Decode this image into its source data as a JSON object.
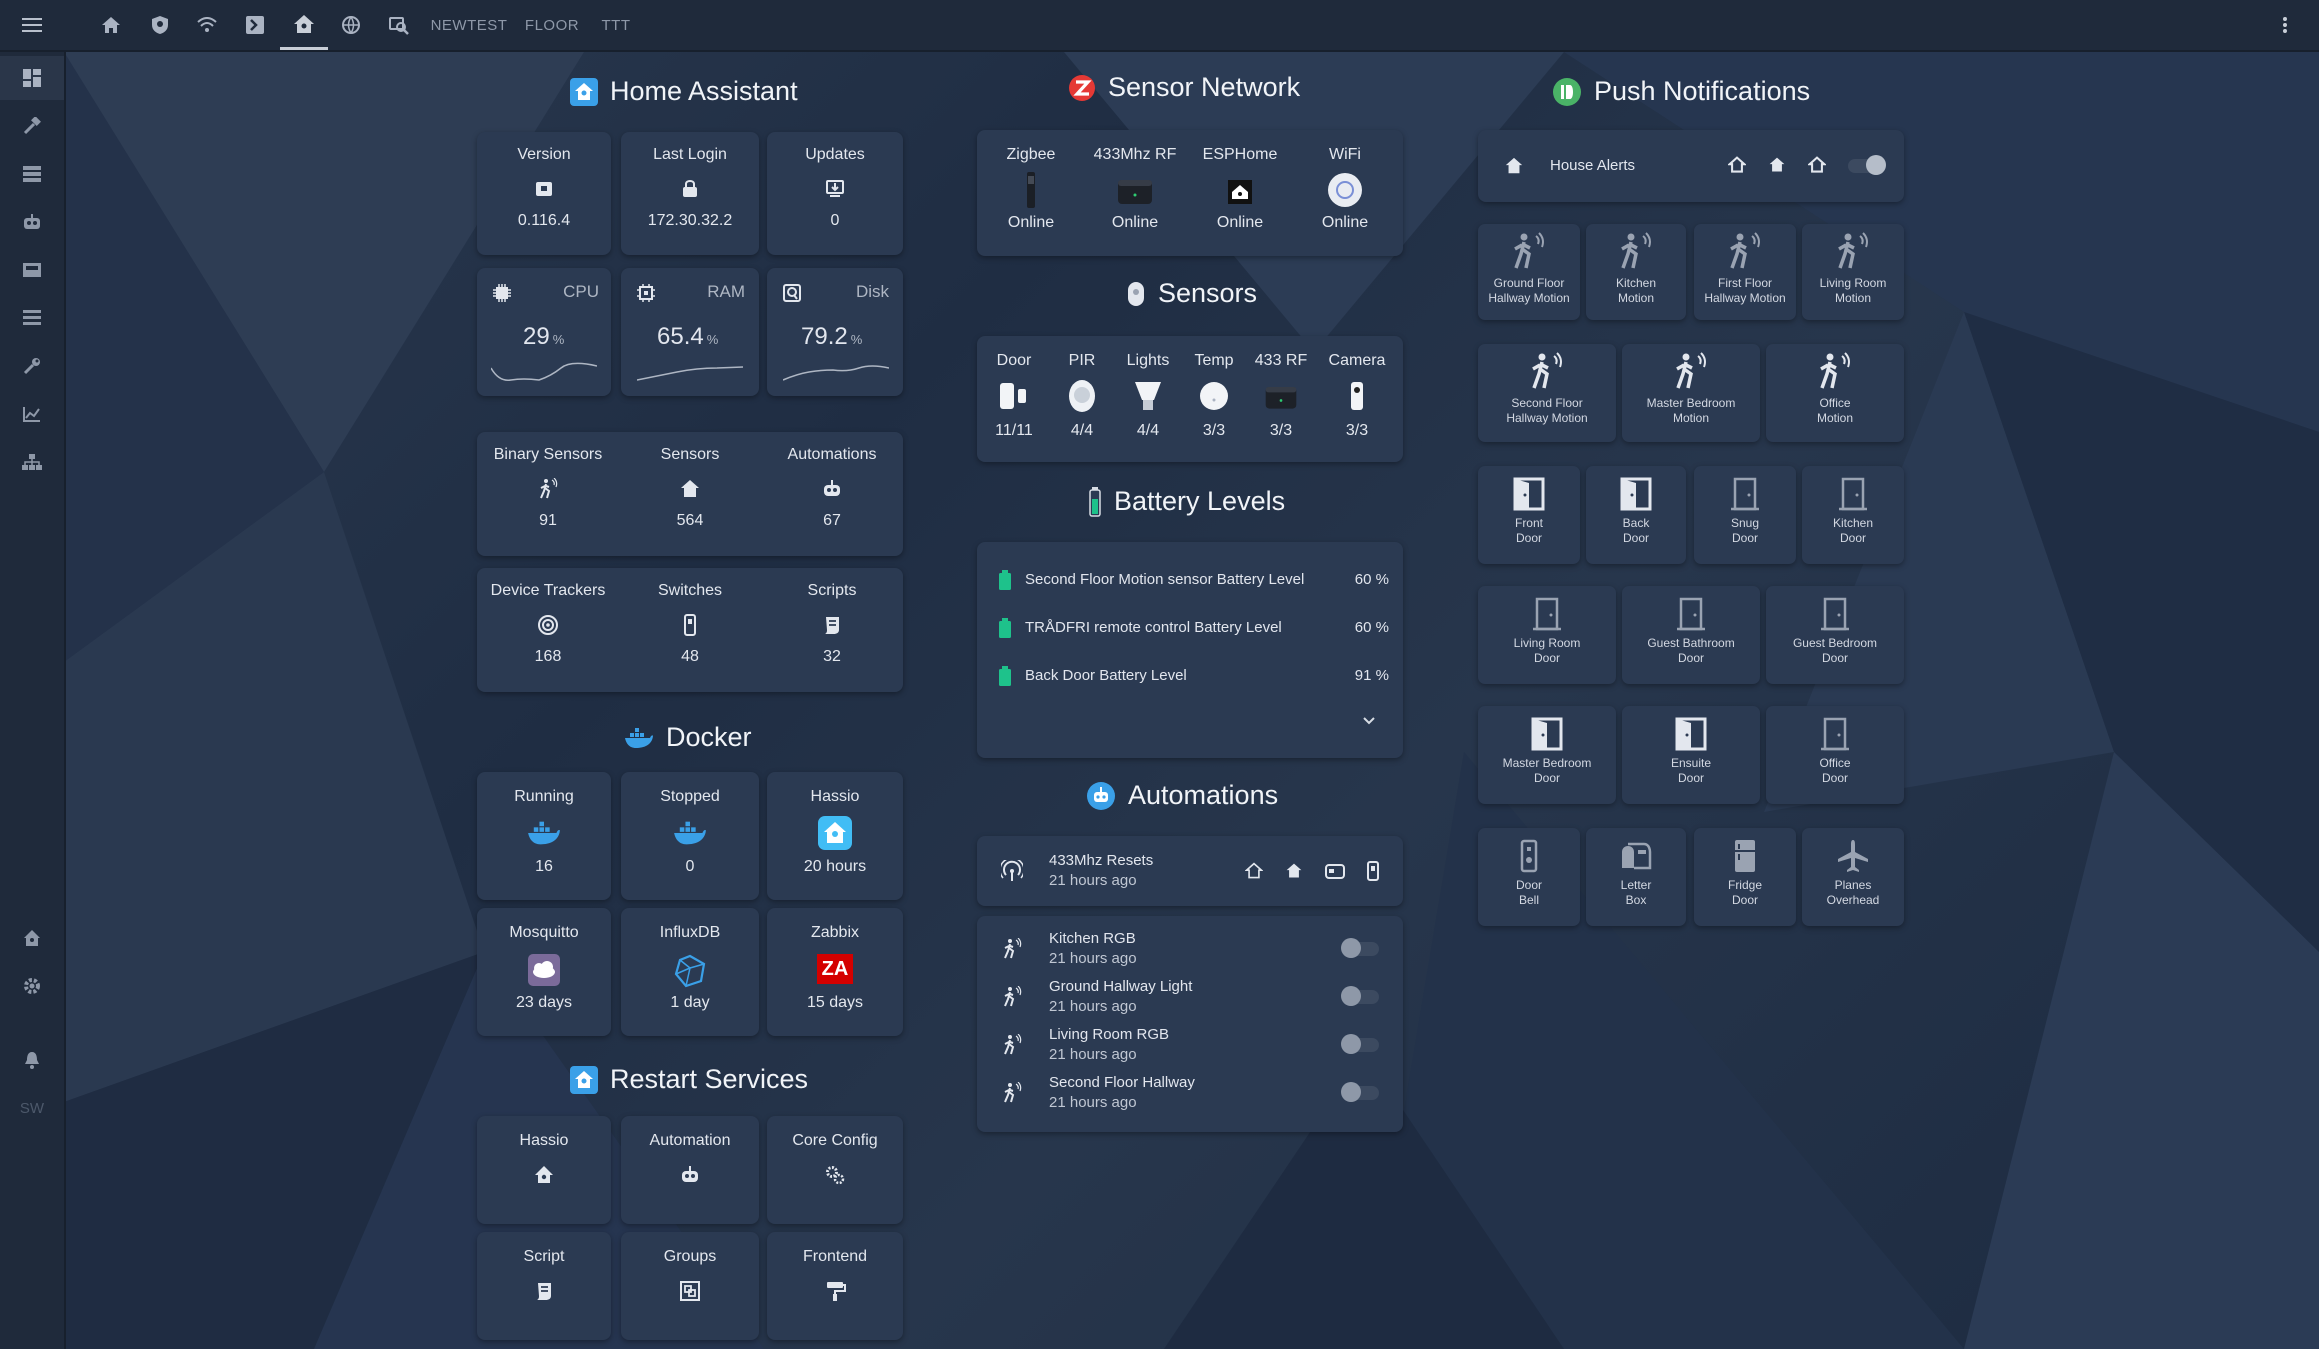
{
  "topbar": {
    "tabs": [
      {
        "icon": "home-icon"
      },
      {
        "icon": "shield-icon"
      },
      {
        "icon": "wifi-icon"
      },
      {
        "icon": "terminal-icon"
      },
      {
        "icon": "home-assistant-icon"
      },
      {
        "icon": "globe-icon"
      },
      {
        "icon": "search-icon"
      }
    ],
    "text_tabs": [
      "NEWTEST",
      "FLOOR",
      "TTT"
    ],
    "menu_icon": "hamburger-icon",
    "more_icon": "dots-vertical-icon"
  },
  "sidebar": {
    "items": [
      "dashboard-icon",
      "hammer-icon",
      "server-icon",
      "robot-icon",
      "hacs-icon",
      "list-icon",
      "wrench-icon",
      "chart-icon",
      "sitemap-icon"
    ],
    "bottom": [
      "hass-icon",
      "gear-icon",
      "bell-icon"
    ],
    "user_initials": "SW"
  },
  "home_assistant": {
    "title": "Home Assistant",
    "stats": [
      {
        "label": "Version",
        "value": "0.116.4",
        "icon": "package-icon"
      },
      {
        "label": "Last Login",
        "value": "172.30.32.2",
        "icon": "lock-icon"
      },
      {
        "label": "Updates",
        "value": "0",
        "icon": "download-icon"
      }
    ],
    "system": [
      {
        "label": "CPU",
        "value": "29",
        "unit": "%",
        "icon": "chip-icon"
      },
      {
        "label": "RAM",
        "value": "65.4",
        "unit": "%",
        "icon": "memory-icon"
      },
      {
        "label": "Disk",
        "value": "79.2",
        "unit": "%",
        "icon": "disk-icon"
      }
    ],
    "counts1": [
      {
        "label": "Binary Sensors",
        "value": "91",
        "icon": "motion-icon"
      },
      {
        "label": "Sensors",
        "value": "564",
        "icon": "home-icon"
      },
      {
        "label": "Automations",
        "value": "67",
        "icon": "robot-icon"
      }
    ],
    "counts2": [
      {
        "label": "Device Trackers",
        "value": "168",
        "icon": "radar-icon"
      },
      {
        "label": "Switches",
        "value": "48",
        "icon": "switch-icon"
      },
      {
        "label": "Scripts",
        "value": "32",
        "icon": "script-icon"
      }
    ]
  },
  "docker": {
    "title": "Docker",
    "row1": [
      {
        "label": "Running",
        "value": "16",
        "icon": "docker-icon"
      },
      {
        "label": "Stopped",
        "value": "0",
        "icon": "docker-icon"
      },
      {
        "label": "Hassio",
        "value": "20 hours",
        "icon": "hass-logo-icon"
      }
    ],
    "row2": [
      {
        "label": "Mosquitto",
        "value": "23 days",
        "icon": "mosquitto-icon"
      },
      {
        "label": "InfluxDB",
        "value": "1 day",
        "icon": "influxdb-icon"
      },
      {
        "label": "Zabbix",
        "value": "15 days",
        "icon": "zabbix-icon",
        "logo": "ZA"
      }
    ]
  },
  "restart": {
    "title": "Restart Services",
    "row1": [
      {
        "label": "Hassio",
        "icon": "hass-icon"
      },
      {
        "label": "Automation",
        "icon": "robot-icon"
      },
      {
        "label": "Core Config",
        "icon": "cogs-icon"
      }
    ],
    "row2": [
      {
        "label": "Script",
        "icon": "script-icon"
      },
      {
        "label": "Groups",
        "icon": "group-icon"
      },
      {
        "label": "Frontend",
        "icon": "paint-roller-icon"
      }
    ]
  },
  "sensor_network": {
    "title": "Sensor Network",
    "items": [
      {
        "label": "Zigbee",
        "value": "Online",
        "icon": "zigbee-stick-icon"
      },
      {
        "label": "433Mhz RF",
        "value": "Online",
        "icon": "rf-bridge-icon"
      },
      {
        "label": "ESPHome",
        "value": "Online",
        "icon": "esphome-icon"
      },
      {
        "label": "WiFi",
        "value": "Online",
        "icon": "wifi-ap-icon"
      }
    ]
  },
  "sensors": {
    "title": "Sensors",
    "items": [
      {
        "label": "Door",
        "value": "11/11",
        "icon": "door-sensor-icon"
      },
      {
        "label": "PIR",
        "value": "4/4",
        "icon": "pir-sensor-icon"
      },
      {
        "label": "Lights",
        "value": "4/4",
        "icon": "bulb-icon"
      },
      {
        "label": "Temp",
        "value": "3/3",
        "icon": "temp-sensor-icon"
      },
      {
        "label": "433 RF",
        "value": "3/3",
        "icon": "rf-bridge-icon"
      },
      {
        "label": "Camera",
        "value": "3/3",
        "icon": "camera-icon"
      }
    ]
  },
  "battery": {
    "title": "Battery Levels",
    "items": [
      {
        "name": "Second Floor Motion sensor Battery Level",
        "value": "60 %",
        "level": 0.6
      },
      {
        "name": "TRÅDFRI remote control Battery Level",
        "value": "60 %",
        "level": 0.6
      },
      {
        "name": "Back Door Battery Level",
        "value": "91 %",
        "level": 0.91
      }
    ],
    "color": "#1ec28b"
  },
  "automations": {
    "title": "Automations",
    "header": {
      "name": "433Mhz Resets",
      "time": "21 hours ago",
      "icon": "radar-icon"
    },
    "list": [
      {
        "name": "Kitchen RGB",
        "time": "21 hours ago",
        "on": false
      },
      {
        "name": "Ground Hallway Light",
        "time": "21 hours ago",
        "on": false
      },
      {
        "name": "Living Room RGB",
        "time": "21 hours ago",
        "on": false
      },
      {
        "name": "Second Floor Hallway",
        "time": "21 hours ago",
        "on": false
      }
    ]
  },
  "push": {
    "title": "Push Notifications",
    "house_alerts": "House Alerts",
    "motion_row1": [
      {
        "name": "Ground Floor Hallway Motion"
      },
      {
        "name": "Kitchen Motion"
      },
      {
        "name": "First Floor Hallway Motion"
      },
      {
        "name": "Living Room Motion"
      }
    ],
    "motion_row2": [
      {
        "name": "Second Floor Hallway Motion"
      },
      {
        "name": "Master Bedroom Motion"
      },
      {
        "name": "Office Motion"
      }
    ],
    "door_row1": [
      {
        "name": "Front Door",
        "active": true
      },
      {
        "name": "Back Door",
        "active": true
      },
      {
        "name": "Snug Door",
        "active": false
      },
      {
        "name": "Kitchen Door",
        "active": false
      }
    ],
    "door_row2": [
      {
        "name": "Living Room Door",
        "active": false
      },
      {
        "name": "Guest Bathroom Door",
        "active": false
      },
      {
        "name": "Guest Bedroom Door",
        "active": false
      }
    ],
    "door_row3": [
      {
        "name": "Master Bedroom Door",
        "active": true
      },
      {
        "name": "Ensuite Door",
        "active": true
      },
      {
        "name": "Office Door",
        "active": false
      }
    ],
    "misc_row": [
      {
        "name": "Door Bell",
        "icon": "doorbell-icon"
      },
      {
        "name": "Letter Box",
        "icon": "mailbox-icon"
      },
      {
        "name": "Fridge Door",
        "icon": "fridge-icon"
      },
      {
        "name": "Planes Overhead",
        "icon": "airplane-icon"
      }
    ]
  },
  "colors": {
    "accent": "#3aa0e8",
    "card": "#2b3a52",
    "topbar": "#1f2a3b",
    "battery": "#1ec28b"
  }
}
